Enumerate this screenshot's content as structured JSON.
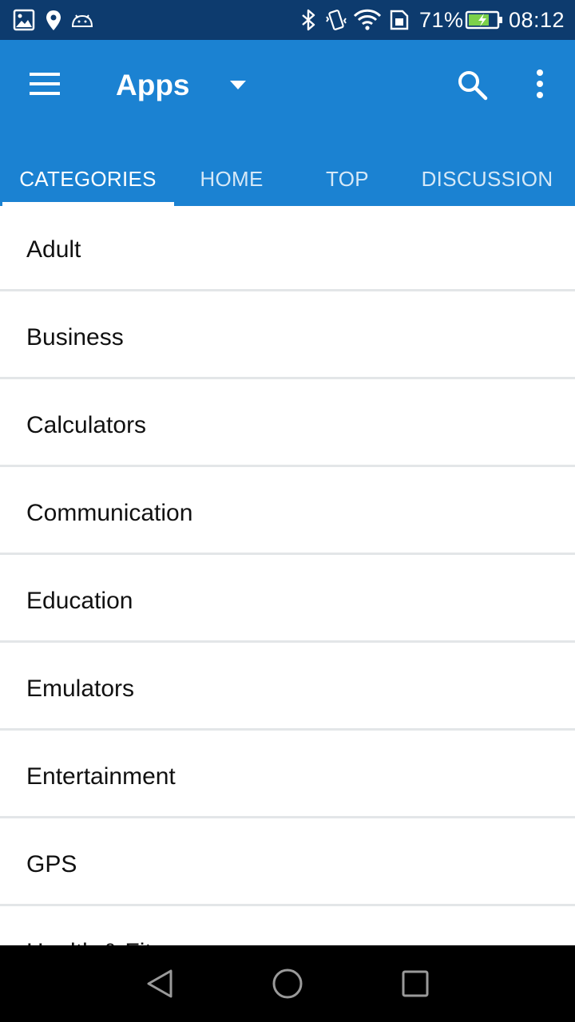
{
  "status_bar": {
    "battery_percent": "71%",
    "time": "08:12",
    "left_icons": [
      "image-icon",
      "location-icon",
      "android-icon"
    ],
    "right_icons": [
      "bluetooth-icon",
      "vibrate-icon",
      "wifi-icon",
      "sim-icon",
      "battery-charging-icon"
    ]
  },
  "app_bar": {
    "title": "Apps",
    "background_color": "#1b82d2",
    "icons": [
      "menu-icon",
      "dropdown-arrow-icon",
      "search-icon",
      "overflow-menu-icon"
    ]
  },
  "tabs": [
    {
      "label": "CATEGORIES",
      "active": true
    },
    {
      "label": "HOME",
      "active": false
    },
    {
      "label": "TOP",
      "active": false
    },
    {
      "label": "DISCUSSION",
      "active": false
    }
  ],
  "categories": [
    {
      "label": "Adult"
    },
    {
      "label": "Business"
    },
    {
      "label": "Calculators"
    },
    {
      "label": "Communication"
    },
    {
      "label": "Education"
    },
    {
      "label": "Emulators"
    },
    {
      "label": "Entertainment"
    },
    {
      "label": "GPS"
    },
    {
      "label": "Health & Fitness"
    }
  ],
  "nav_bar": {
    "icons": [
      "back-icon",
      "home-icon",
      "recents-icon"
    ]
  }
}
